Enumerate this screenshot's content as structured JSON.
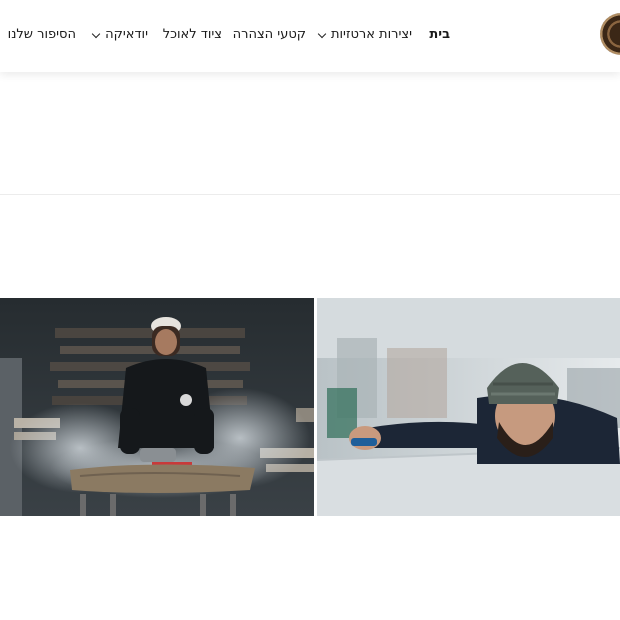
{
  "header": {
    "logo_icon": "round-seal-logo-icon",
    "nav": [
      {
        "label": "בית",
        "active": true
      },
      {
        "label": "יצירות ארטזיות",
        "dropdown": true
      },
      {
        "label": "קטעי הצהרה"
      },
      {
        "label": "ציוד לאוכל"
      },
      {
        "label": "יודאיקה",
        "dropdown": true
      },
      {
        "label": "הסיפור שלנו"
      }
    ]
  },
  "gallery": {
    "left_photo": "craftsman-grinding-wood-slab",
    "right_photo": "craftsman-in-beanie-sanding-table"
  }
}
